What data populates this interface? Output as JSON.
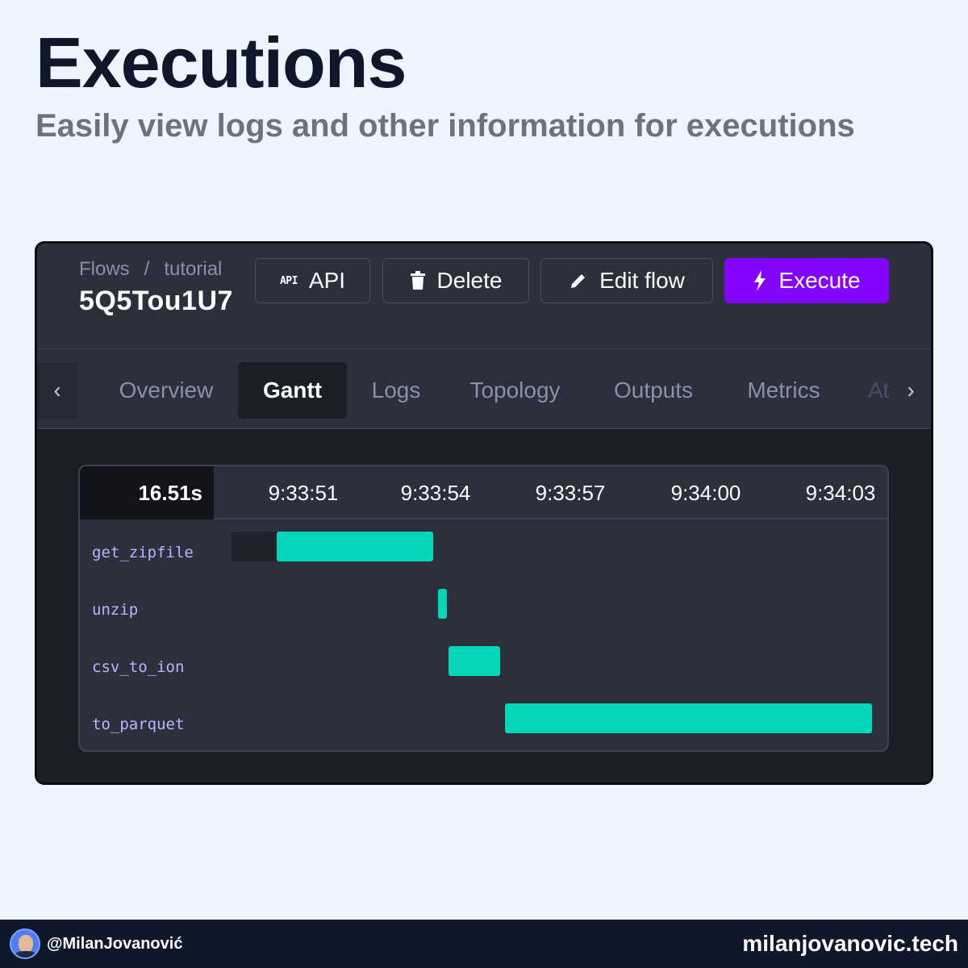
{
  "page": {
    "title": "Executions",
    "subtitle": "Easily view logs and other information for executions"
  },
  "header": {
    "breadcrumb": [
      "Flows",
      "/",
      "tutorial"
    ],
    "flow_id": "5Q5Tou1U7"
  },
  "toolbar": {
    "api_icon_text": "API",
    "api_label": "API",
    "delete_label": "Delete",
    "edit_label": "Edit flow",
    "execute_label": "Execute",
    "execute_color": "#8405ff"
  },
  "tabs": [
    {
      "label": "Overview",
      "active": false
    },
    {
      "label": "Gantt",
      "active": true
    },
    {
      "label": "Logs",
      "active": false
    },
    {
      "label": "Topology",
      "active": false
    },
    {
      "label": "Outputs",
      "active": false
    },
    {
      "label": "Metrics",
      "active": false
    },
    {
      "label": "At",
      "active": false
    }
  ],
  "gantt": {
    "duration": "16.51s",
    "time_ticks": [
      "9:33:51",
      "9:33:54",
      "9:33:57",
      "9:34:00",
      "9:34:03"
    ],
    "bar_color": "#04d7b9",
    "tasks": [
      {
        "name": "get_zipfile",
        "queued_start_s": 0.0,
        "start_s": 1.0,
        "end_s": 4.5
      },
      {
        "name": "unzip",
        "start_s": 4.6,
        "end_s": 4.8
      },
      {
        "name": "csv_to_ion",
        "start_s": 4.85,
        "end_s": 6.0
      },
      {
        "name": "to_parquet",
        "start_s": 6.1,
        "end_s": 14.3
      }
    ]
  },
  "footer": {
    "handle": "@MilanJovanović",
    "website": "milanjovanovic.tech"
  }
}
